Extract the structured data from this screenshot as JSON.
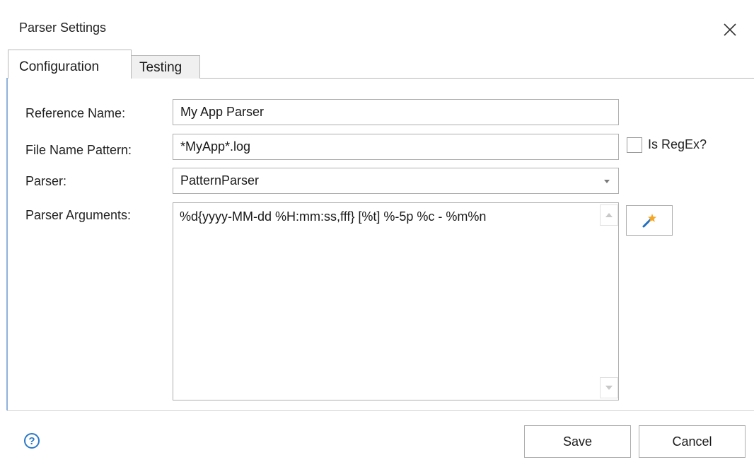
{
  "window": {
    "title": "Parser Settings"
  },
  "tabs": [
    {
      "label": "Configuration",
      "active": true
    },
    {
      "label": "Testing",
      "active": false
    }
  ],
  "form": {
    "reference_name": {
      "label": "Reference Name:",
      "value": "My App Parser"
    },
    "file_name_pattern": {
      "label": "File Name Pattern:",
      "value": "*MyApp*.log"
    },
    "is_regex": {
      "label": "Is RegEx?",
      "checked": false
    },
    "parser": {
      "label": "Parser:",
      "selected": "PatternParser"
    },
    "parser_arguments": {
      "label": "Parser Arguments:",
      "value": "%d{yyyy-MM-dd %H:mm:ss,fff} [%t] %-5p %c - %m%n"
    }
  },
  "footer": {
    "help": "?",
    "save_label": "Save",
    "cancel_label": "Cancel"
  },
  "colors": {
    "accent": "#2b79c8",
    "wand_star": "#f5a623",
    "wand_stick": "#1f6fc2"
  }
}
